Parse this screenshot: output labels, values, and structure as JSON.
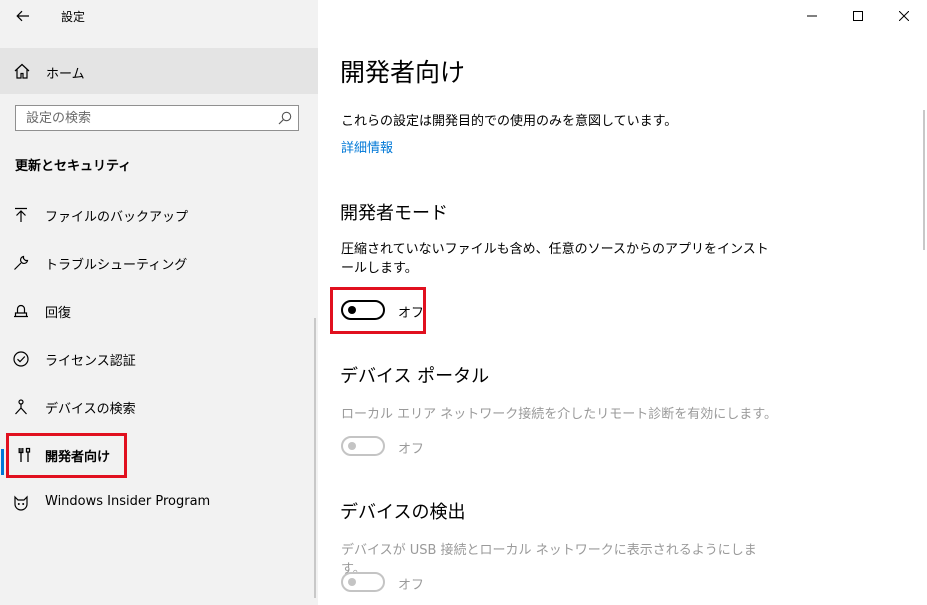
{
  "window": {
    "title": "設定"
  },
  "sidebar": {
    "home_label": "ホーム",
    "search_placeholder": "設定の検索",
    "section_title": "更新とセキュリティ",
    "items": [
      {
        "label": "ファイルのバックアップ",
        "icon": "backup-arrow-icon"
      },
      {
        "label": "トラブルシューティング",
        "icon": "wrench-icon"
      },
      {
        "label": "回復",
        "icon": "recovery-icon"
      },
      {
        "label": "ライセンス認証",
        "icon": "check-circle-icon"
      },
      {
        "label": "デバイスの検索",
        "icon": "person-locate-icon"
      },
      {
        "label": "開発者向け",
        "icon": "developer-tools-icon",
        "selected": true
      },
      {
        "label": "Windows Insider Program",
        "icon": "insider-cat-icon"
      }
    ]
  },
  "main": {
    "title": "開発者向け",
    "description": "これらの設定は開発目的での使用のみを意図しています。",
    "link": "詳細情報",
    "sections": [
      {
        "title": "開発者モード",
        "description": "圧縮されていないファイルも含め、任意のソースからのアプリをインストールします。",
        "toggle_label": "オフ",
        "enabled": true
      },
      {
        "title": "デバイス ポータル",
        "description": "ローカル エリア ネットワーク接続を介したリモート診断を有効にします。",
        "toggle_label": "オフ",
        "enabled": false
      },
      {
        "title": "デバイスの検出",
        "description": "デバイスが USB 接続とローカル ネットワークに表示されるようにします。",
        "toggle_label": "オフ",
        "enabled": false
      }
    ]
  },
  "colors": {
    "accent": "#0078d7",
    "highlight": "#e1101f",
    "sidebar_bg": "#f2f2f2"
  }
}
